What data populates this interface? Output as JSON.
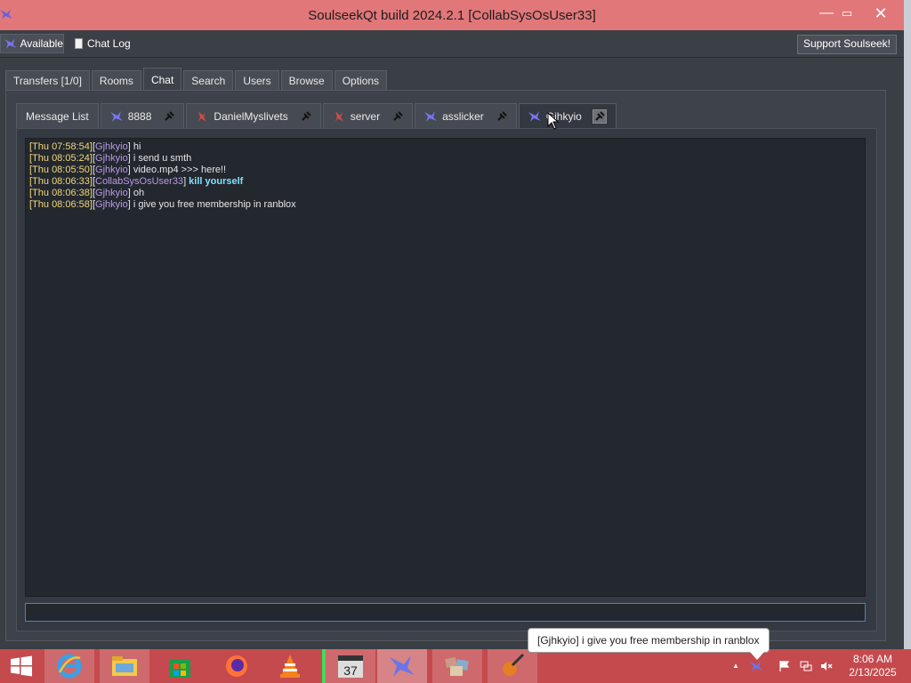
{
  "window": {
    "title": "SoulseekQt build 2024.2.1 [CollabSysOsUser33]",
    "minimize": "—",
    "maximize": "▭",
    "close": "✕"
  },
  "toolbar": {
    "status_label": "Available",
    "chatlog_label": "Chat Log",
    "support_label": "Support Soulseek!"
  },
  "main_tabs": [
    {
      "label": "Transfers [1/0]"
    },
    {
      "label": "Rooms"
    },
    {
      "label": "Chat"
    },
    {
      "label": "Search"
    },
    {
      "label": "Users"
    },
    {
      "label": "Browse"
    },
    {
      "label": "Options"
    }
  ],
  "chat_tabs": [
    {
      "label": "Message List",
      "icon": "none"
    },
    {
      "label": "8888",
      "icon": "blue-bird-icon"
    },
    {
      "label": "DanielMyslivets",
      "icon": "red-bird-icon"
    },
    {
      "label": "server",
      "icon": "red-bird-icon"
    },
    {
      "label": "asslicker",
      "icon": "blue-bird-icon"
    },
    {
      "label": "Gjhkyio",
      "icon": "blue-bird-icon"
    }
  ],
  "messages": [
    {
      "ts": "[Thu 07:58:54]",
      "user": "Gjhkyio",
      "text": " hi"
    },
    {
      "ts": "[Thu 08:05:24]",
      "user": "Gjhkyio",
      "text": " i send u smth"
    },
    {
      "ts": "[Thu 08:05:50]",
      "user": "Gjhkyio",
      "text": " video.mp4 >>> here!!"
    },
    {
      "ts": "[Thu 08:06:33]",
      "user": "CollabSysOsUser33",
      "text": " kill yourself",
      "bold": true
    },
    {
      "ts": "[Thu 08:06:38]",
      "user": "Gjhkyio",
      "text": " oh"
    },
    {
      "ts": "[Thu 08:06:58]",
      "user": "Gjhkyio",
      "text": " i give you free membership in ranblox"
    }
  ],
  "input": {
    "value": "",
    "placeholder": ""
  },
  "taskbar": {
    "tooltip": "[Gjhkyio] i give you free membership in ranblox",
    "clock_time": "8:06 AM",
    "clock_date": "2/13/2025",
    "calendar_day": "37",
    "tray_up": "▲"
  },
  "colors": {
    "titlebar": "#e2777a",
    "taskbar": "#c44a4e",
    "timestamp": "#f0d97a",
    "username": "#b79be6",
    "highlight": "#7fe0ff"
  }
}
